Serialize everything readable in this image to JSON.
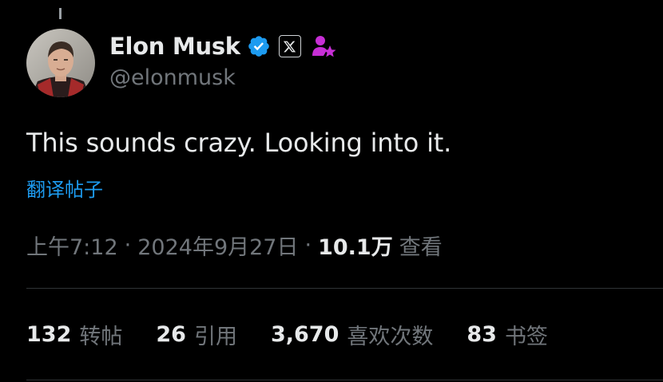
{
  "author": {
    "display_name": "Elon Musk",
    "handle": "@elonmusk",
    "verified_icon": "verified-badge-icon",
    "affiliate_icon": "x-logo-icon",
    "highlight_icon": "person-star-icon",
    "avatar_icon": "profile-photo"
  },
  "tweet": {
    "text": "This sounds crazy. Looking into it.",
    "translate_label": "翻译帖子"
  },
  "meta": {
    "time": "上午7:12",
    "separator": "·",
    "date": "2024年9月27日",
    "views_count": "10.1万",
    "views_label": "查看"
  },
  "stats": [
    {
      "count": "132",
      "label": "转帖"
    },
    {
      "count": "26",
      "label": "引用"
    },
    {
      "count": "3,670",
      "label": "喜欢次数"
    },
    {
      "count": "83",
      "label": "书签"
    }
  ],
  "colors": {
    "background": "#000000",
    "primary_text": "#e7e9ea",
    "secondary_text": "#71767b",
    "link": "#1d9bf0",
    "verified": "#1d9bf0",
    "accent_magenta": "#c72fd6",
    "divider": "#2f3336"
  }
}
